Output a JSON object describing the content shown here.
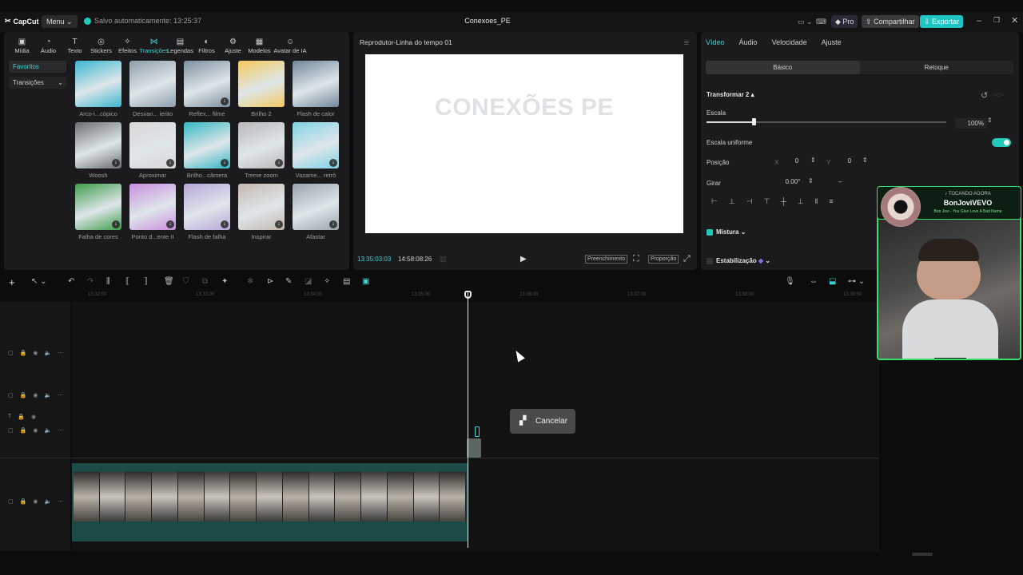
{
  "titlebar": {
    "app_name": "CapCut",
    "menu_label": "Menu",
    "saved_status": "Salvo automaticamente: 13:25:37",
    "project_name": "Conexoes_PE",
    "pro_label": "Pro",
    "share_label": "Compartilhar",
    "export_label": "Exportar"
  },
  "left_toolbar": [
    {
      "label": "Mídia",
      "icon": "media-icon"
    },
    {
      "label": "Áudio",
      "icon": "audio-icon"
    },
    {
      "label": "Texto",
      "icon": "text-icon"
    },
    {
      "label": "Stickers",
      "icon": "sticker-icon"
    },
    {
      "label": "Efeitos",
      "icon": "effects-icon"
    },
    {
      "label": "Transições",
      "icon": "transitions-icon"
    },
    {
      "label": "Legendas",
      "icon": "captions-icon"
    },
    {
      "label": "Filtros",
      "icon": "filters-icon"
    },
    {
      "label": "Ajuste",
      "icon": "adjust-icon"
    },
    {
      "label": "Modelos",
      "icon": "templates-icon"
    },
    {
      "label": "Avatar de IA",
      "icon": "ai-avatar-icon"
    }
  ],
  "sidebar": {
    "favorites": "Favoritos",
    "transitions": "Transições"
  },
  "transitions": [
    {
      "label": "Arco-i...cópico",
      "color": "#39b6cf",
      "download": false
    },
    {
      "label": "Desvan... ierito",
      "color": "#8e9eab",
      "download": false
    },
    {
      "label": "Reflex... filme",
      "color": "#7c8f9e",
      "download": true
    },
    {
      "label": "Brilho 2",
      "color": "#f4c95d",
      "download": false
    },
    {
      "label": "Flash de calor",
      "color": "#6f8799",
      "download": false
    },
    {
      "label": "Woosh",
      "color": "#6a6e73",
      "download": true
    },
    {
      "label": "Aproximar",
      "color": "#d7d7d7",
      "download": true
    },
    {
      "label": "Brilho...câmera",
      "color": "#32b7c2",
      "download": true
    },
    {
      "label": "Treme zoom",
      "color": "#b8b8b8",
      "download": true
    },
    {
      "label": "Vazame... retrô",
      "color": "#7fd3e6",
      "download": true
    },
    {
      "label": "Falha de cores",
      "color": "#3e9c4a",
      "download": true
    },
    {
      "label": "Ponto d...ente II",
      "color": "#c98fe0",
      "download": true
    },
    {
      "label": "Flash de falha",
      "color": "#b7a6d9",
      "download": true
    },
    {
      "label": "Inspirar",
      "color": "#c4b8ae",
      "download": true
    },
    {
      "label": "Afastar",
      "color": "#9aa4ad",
      "download": true
    }
  ],
  "player": {
    "title": "Reprodutor-Linha do tempo 01",
    "screen_text": "CONEXÕES PE",
    "current_time": "13:35:03:03",
    "total_time": "14:58:08:26",
    "fill_label": "Preenchimento",
    "ratio_label": "Proporção"
  },
  "props": {
    "tabs": [
      "Vídeo",
      "Áudio",
      "Velocidade",
      "Ajuste"
    ],
    "seg_basic": "Básico",
    "seg_retouch": "Retoque",
    "transform": "Transformar 2",
    "scale_label": "Escala",
    "scale_value": "100%",
    "uniform_scale": "Escala uniforme",
    "position_label": "Posição",
    "pos_x_label": "X",
    "pos_x": "0",
    "pos_y_label": "Y",
    "pos_y": "0",
    "rotate_label": "Girar",
    "rotate_value": "0.00°",
    "blend_label": "Mistura",
    "stabilize_label": "Estabilização"
  },
  "timeline": {
    "ruler": [
      "13:32:00",
      "13:33:00",
      "13:34:00",
      "13:35:00",
      "13:36:00",
      "13:37:00",
      "13:38:00",
      "13:39:00",
      "13:40:00"
    ],
    "cancel_label": "Cancelar"
  },
  "overlay": {
    "now_playing": "♪ TOCANDO AGORA",
    "artist": "BonJoviVEVO",
    "song": "Bon Jovi - You Give Love A Bad Name"
  }
}
